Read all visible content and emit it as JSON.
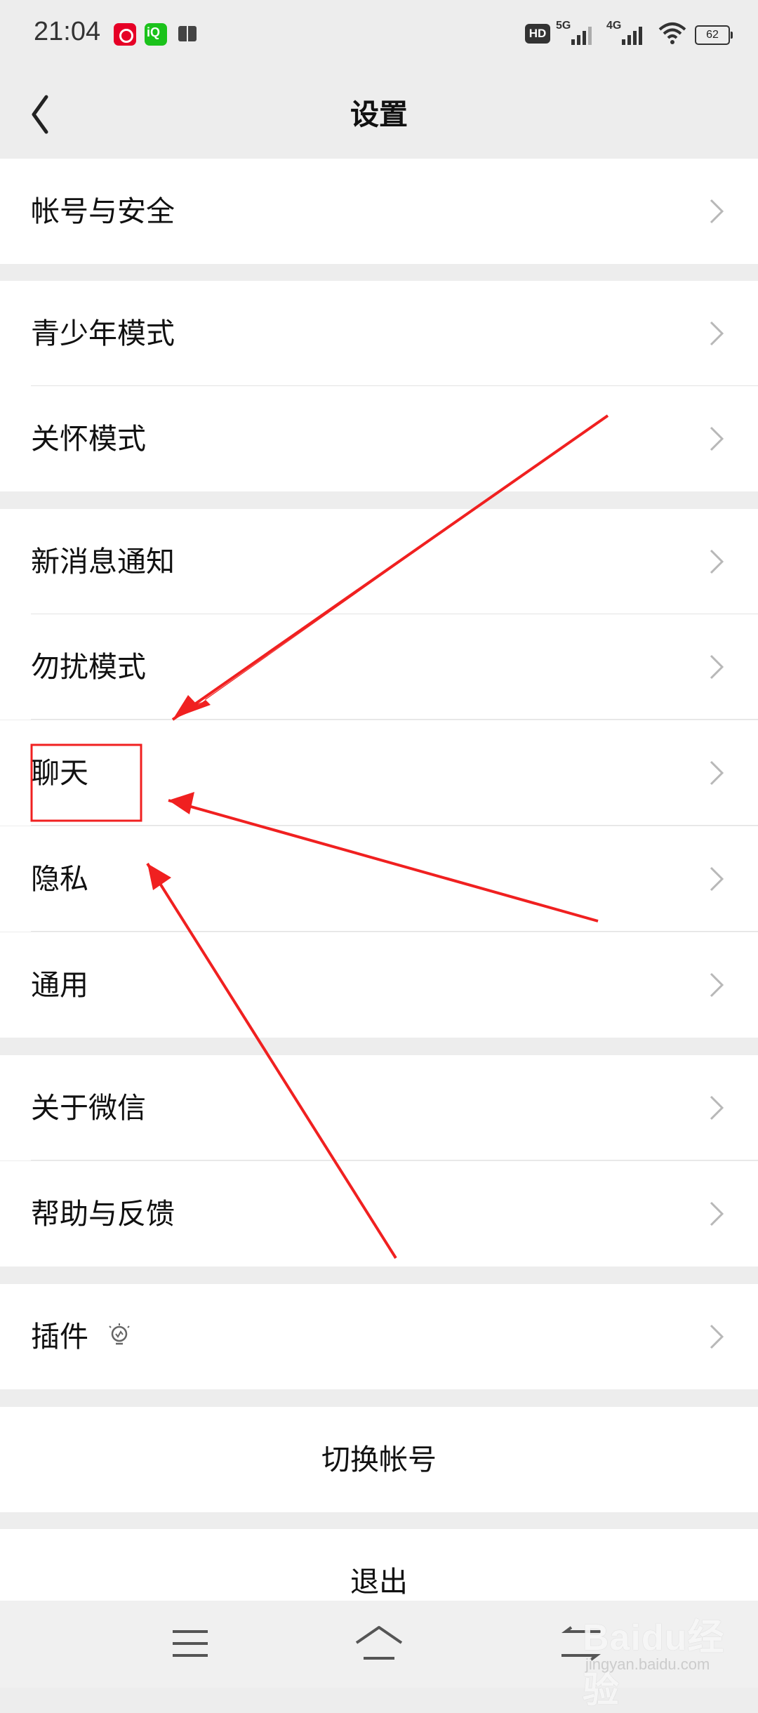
{
  "status_bar": {
    "time": "21:04",
    "hd_label": "HD",
    "network_1": "5G",
    "network_2": "4G",
    "battery": "62"
  },
  "header": {
    "title": "设置"
  },
  "settings": {
    "account_security": "帐号与安全",
    "youth_mode": "青少年模式",
    "care_mode": "关怀模式",
    "new_message_notification": "新消息通知",
    "do_not_disturb": "勿扰模式",
    "chat": "聊天",
    "privacy": "隐私",
    "general": "通用",
    "about_wechat": "关于微信",
    "help_feedback": "帮助与反馈",
    "plugins": "插件"
  },
  "actions": {
    "switch_account": "切换帐号",
    "logout": "退出"
  },
  "watermark": {
    "text": "Baidu经验",
    "sub": "jingyan.baidu.com"
  },
  "colors": {
    "background": "#ededed",
    "annotation_red": "#f02020"
  },
  "icons": {
    "back": "chevron-left-icon",
    "row_arrow": "chevron-right-icon",
    "plugin": "lightbulb-icon"
  }
}
